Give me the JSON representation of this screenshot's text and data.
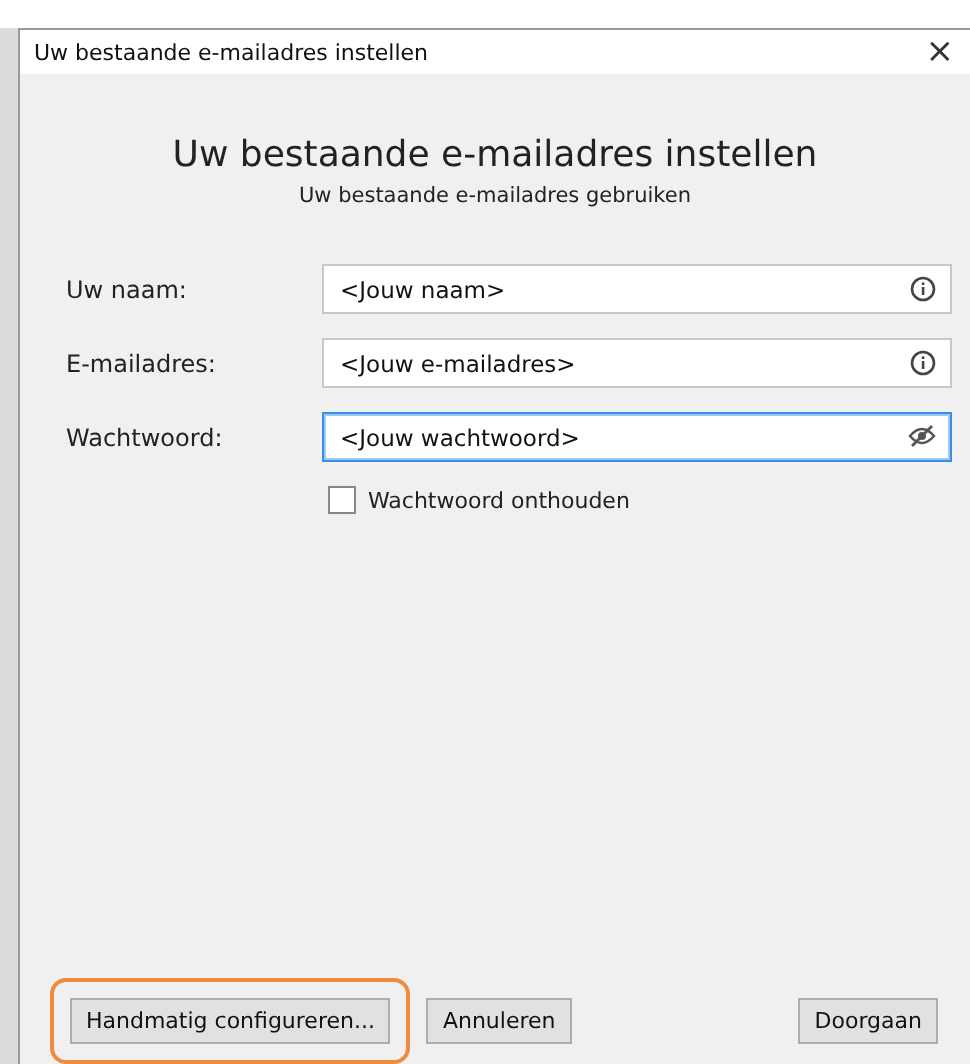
{
  "window": {
    "title": "Uw bestaande e-mailadres instellen",
    "close": "×"
  },
  "heading": "Uw bestaande e-mailadres instellen",
  "subheading": "Uw bestaande e-mailadres gebruiken",
  "fields": [
    {
      "label": "Uw naam:",
      "value": "<Jouw naam>",
      "kind": "info",
      "focused": false
    },
    {
      "label": "E-mailadres:",
      "value": "<Jouw e-mailadres>",
      "kind": "info",
      "focused": false
    },
    {
      "label": "Wachtwoord:",
      "value": "<Jouw wachtwoord>",
      "kind": "password",
      "focused": true
    }
  ],
  "remember": {
    "label": "Wachtwoord onthouden",
    "checked": false
  },
  "buttons_left": [
    {
      "label": "Handmatig configureren...",
      "highlighted": true
    },
    {
      "label": "Annuleren",
      "highlighted": false
    }
  ],
  "buttons_right": [
    {
      "label": "Doorgaan",
      "highlighted": false
    }
  ]
}
